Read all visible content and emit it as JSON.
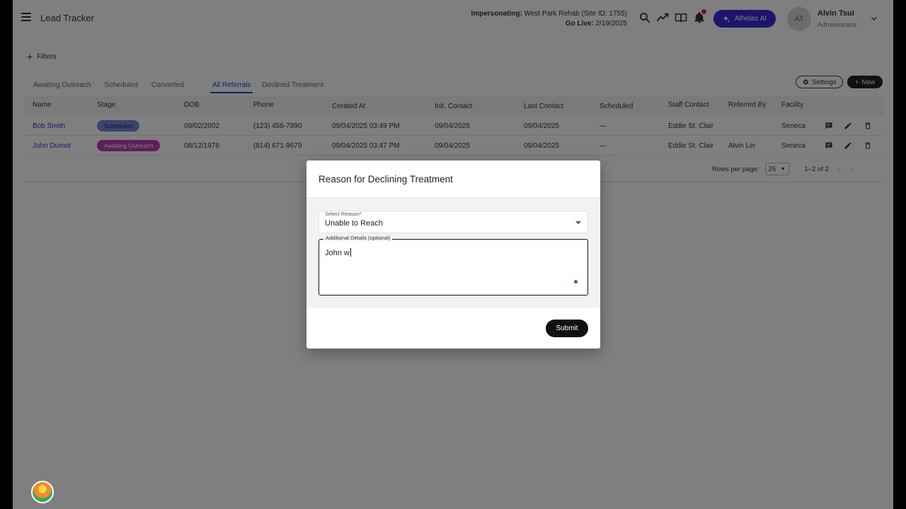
{
  "header": {
    "app_title": "Lead Tracker",
    "impersonating_label": "Impersonating:",
    "impersonating_value": "West Park Rehab (Site ID: 1755)",
    "go_live_label": "Go Live:",
    "go_live_value": "2/19/2025",
    "ai_button": "Athelas AI",
    "avatar_initials": "AT",
    "user_name": "Alvin Tsui",
    "user_role": "Administrator",
    "accent_color": "#3b2bd8"
  },
  "filters": {
    "label": "Filters"
  },
  "tabs": [
    {
      "label": "Awaiting Outreach"
    },
    {
      "label": "Scheduled"
    },
    {
      "label": "Converted"
    },
    {
      "label": "All Referrals",
      "active": true
    },
    {
      "label": "Declined Treatment"
    }
  ],
  "toolbar": {
    "settings_label": "Settings",
    "new_label": "New"
  },
  "table": {
    "columns": [
      "Name",
      "Stage",
      "DOB",
      "Phone",
      "Created At",
      "Init. Contact",
      "Last Contact",
      "Scheduled",
      "Staff Contact",
      "Referred By",
      "Facility"
    ],
    "rows": [
      {
        "name": "Bob Smith",
        "stage": "Scheduled",
        "dob": "09/02/2002",
        "phone": "(123) 456-7890",
        "created_at": "09/04/2025 03:49 PM",
        "init_contact": "09/04/2025",
        "last_contact": "09/04/2025",
        "scheduled": "—",
        "staff_contact": "Eddie St. Clair",
        "referred_by": "",
        "facility": "Seneca"
      },
      {
        "name": "John Dumot",
        "stage": "Awaiting Outreach",
        "dob": "08/12/1976",
        "phone": "(814) 671-9679",
        "created_at": "09/04/2025 03:47 PM",
        "init_contact": "09/04/2025",
        "last_contact": "09/04/2025",
        "scheduled": "—",
        "staff_contact": "Eddie St. Clair",
        "referred_by": "Alvin Lin",
        "facility": "Seneca"
      }
    ]
  },
  "pagination": {
    "rows_per_page_label": "Rows per page:",
    "rows_per_page": "25",
    "range": "1–2 of 2"
  },
  "modal": {
    "title": "Reason for Declining Treatment",
    "select_label": "Select Reason*",
    "select_value": "Unable to Reach",
    "details_label": "Additional Details (optional)",
    "details_value": "John w",
    "submit_label": "Submit"
  }
}
